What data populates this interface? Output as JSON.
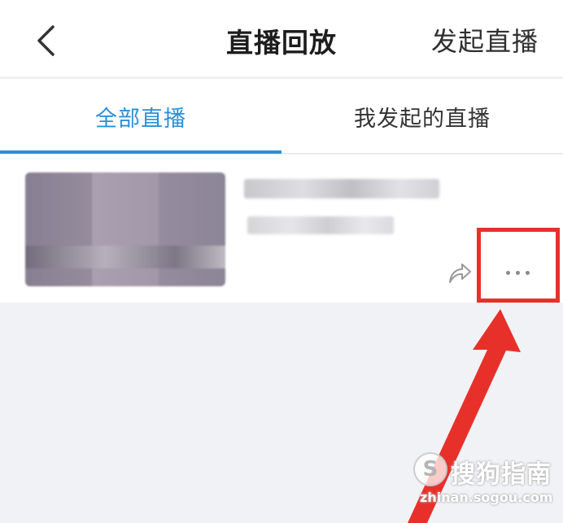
{
  "header": {
    "title": "直播回放",
    "back_icon": "chevron-left-icon",
    "start_live_label": "发起直播"
  },
  "tabs": [
    {
      "label": "全部直播",
      "active": true
    },
    {
      "label": "我发起的直播",
      "active": false
    }
  ],
  "live_item": {
    "share_icon": "share-arrow-icon",
    "more_icon": "more-dots-icon"
  },
  "watermark": {
    "logo_glyph": "S",
    "name": "搜狗指南",
    "url": "zhinan.sogou.com"
  },
  "colors": {
    "accent": "#2a90d8",
    "highlight": "#e8302b",
    "page_bg": "#f1f2f6"
  }
}
